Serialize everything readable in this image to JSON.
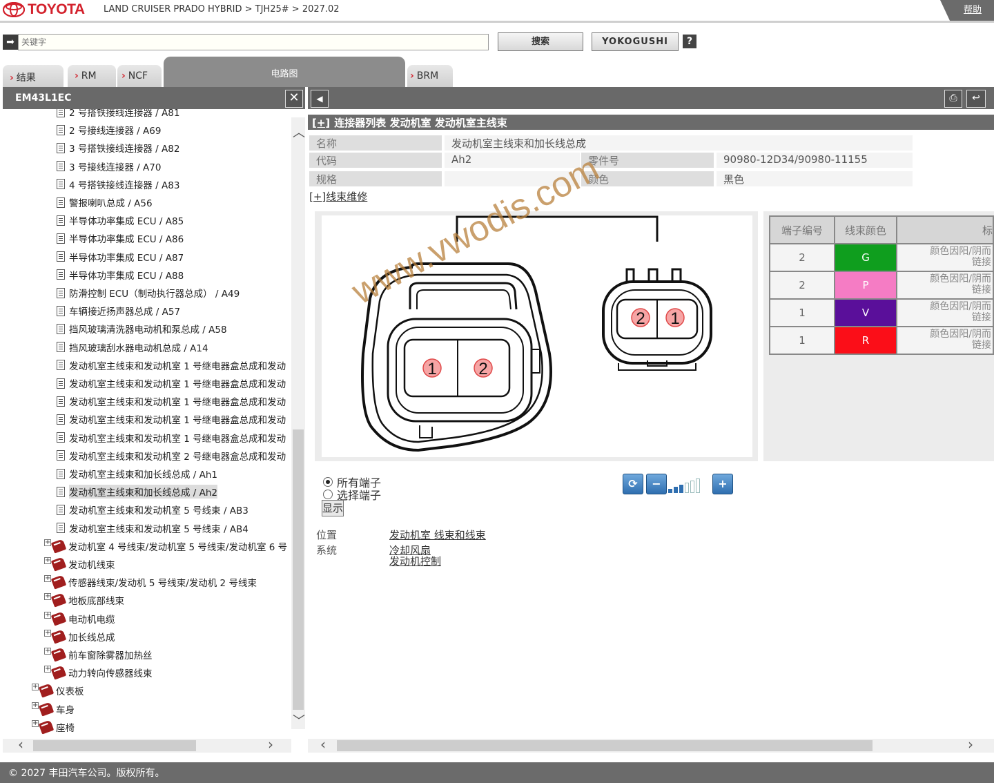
{
  "brand": {
    "name": "TOYOTA"
  },
  "breadcrumb": "LAND CRUISER PRADO HYBRID > TJH25# > 2027.02",
  "help_label": "帮助",
  "search": {
    "placeholder": "关键字",
    "search_label": "搜索",
    "yokogushi_label": "YOKOGUSHI",
    "help_q": "?"
  },
  "tabs": [
    {
      "label": "结果"
    },
    {
      "label": "RM"
    },
    {
      "label": "NCF"
    },
    {
      "label": "电路图"
    },
    {
      "label": "BRM"
    }
  ],
  "left_panel": {
    "title": "EM43L1EC",
    "close": "✕",
    "items": [
      {
        "label": "2 号搭铁接线连接器 / A81",
        "type": "doc"
      },
      {
        "label": "2 号接线连接器 / A69",
        "type": "doc"
      },
      {
        "label": "3 号搭铁接线连接器 / A82",
        "type": "doc"
      },
      {
        "label": "3 号接线连接器 / A70",
        "type": "doc"
      },
      {
        "label": "4 号搭铁接线连接器 / A83",
        "type": "doc"
      },
      {
        "label": "警报喇叭总成 / A56",
        "type": "doc"
      },
      {
        "label": "半导体功率集成 ECU / A85",
        "type": "doc"
      },
      {
        "label": "半导体功率集成 ECU / A86",
        "type": "doc"
      },
      {
        "label": "半导体功率集成 ECU / A87",
        "type": "doc"
      },
      {
        "label": "半导体功率集成 ECU / A88",
        "type": "doc"
      },
      {
        "label": "防滑控制 ECU（制动执行器总成） / A49",
        "type": "doc"
      },
      {
        "label": "车辆接近扬声器总成 / A57",
        "type": "doc"
      },
      {
        "label": "挡风玻璃清洗器电动机和泵总成 / A58",
        "type": "doc"
      },
      {
        "label": "挡风玻璃刮水器电动机总成 / A14",
        "type": "doc"
      },
      {
        "label": "发动机室主线束和发动机室 1 号继电器盒总成和发动",
        "type": "doc"
      },
      {
        "label": "发动机室主线束和发动机室 1 号继电器盒总成和发动",
        "type": "doc"
      },
      {
        "label": "发动机室主线束和发动机室 1 号继电器盒总成和发动",
        "type": "doc"
      },
      {
        "label": "发动机室主线束和发动机室 1 号继电器盒总成和发动",
        "type": "doc"
      },
      {
        "label": "发动机室主线束和发动机室 1 号继电器盒总成和发动",
        "type": "doc"
      },
      {
        "label": "发动机室主线束和发动机室 2 号继电器盒总成和发动",
        "type": "doc"
      },
      {
        "label": "发动机室主线束和加长线总成 / Ah1",
        "type": "doc"
      },
      {
        "label": "发动机室主线束和加长线总成 / Ah2",
        "type": "doc",
        "selected": true
      },
      {
        "label": "发动机室主线束和发动机室 5 号线束 / AB3",
        "type": "doc"
      },
      {
        "label": "发动机室主线束和发动机室 5 号线束 / AB4",
        "type": "doc"
      },
      {
        "label": "发动机室 4 号线束/发动机室 5 号线束/发动机室 6 号",
        "type": "book"
      },
      {
        "label": "发动机线束",
        "type": "book"
      },
      {
        "label": "传感器线束/发动机 5 号线束/发动机 2 号线束",
        "type": "book"
      },
      {
        "label": "地板底部线束",
        "type": "book"
      },
      {
        "label": "电动机电缆",
        "type": "book"
      },
      {
        "label": "加长线总成",
        "type": "book"
      },
      {
        "label": "前车窗除雾器加热丝",
        "type": "book"
      },
      {
        "label": "动力转向传感器线束",
        "type": "book"
      },
      {
        "label": "仪表板",
        "type": "book2"
      },
      {
        "label": "车身",
        "type": "book2"
      },
      {
        "label": "座椅",
        "type": "book2"
      }
    ]
  },
  "section": {
    "plus": "[+]",
    "title": "连接器列表  发动机室  发动机室主线束",
    "repair_link": "[+]线束维修"
  },
  "info": {
    "name_label": "名称",
    "name_value": "发动机室主线束和加长线总成",
    "code_label": "代码",
    "code_value": "Ah2",
    "part_label": "零件号",
    "part_value": "90980-12D34/90980-11155",
    "spec_label": "规格",
    "spec_value": "",
    "color_label": "颜色",
    "color_value": "黑色"
  },
  "diagram": {
    "pins_left": [
      "1",
      "2"
    ],
    "pins_right": [
      "2",
      "1"
    ],
    "watermark": "www.vwodis.com"
  },
  "terminals": {
    "headers": [
      "端子编号",
      "线束颜色",
      "标"
    ],
    "rows": [
      {
        "no": "2",
        "color": "G",
        "hex": "#0f9e1e",
        "note1": "颜色因阳/阴而",
        "note2": "链接"
      },
      {
        "no": "2",
        "color": "P",
        "hex": "#f57cc4",
        "note1": "颜色因阳/阴而",
        "note2": "链接"
      },
      {
        "no": "1",
        "color": "V",
        "hex": "#5a0f9a",
        "note1": "颜色因阳/阴而",
        "note2": "链接"
      },
      {
        "no": "1",
        "color": "R",
        "hex": "#fb0e18",
        "note1": "颜色因阳/阴而",
        "note2": "链接"
      }
    ]
  },
  "controls": {
    "all_terminals": "所有端子",
    "select_terminals": "选择端子",
    "show": "显示"
  },
  "zoom": {
    "levels_total": 6,
    "level": 3
  },
  "meta": {
    "location_label": "位置",
    "location_value": "发动机室  线束和线束",
    "system_label": "系统",
    "system_values": [
      "冷却风扇",
      "发动机控制"
    ]
  },
  "footer": "© 2027 丰田汽车公司。版权所有。"
}
